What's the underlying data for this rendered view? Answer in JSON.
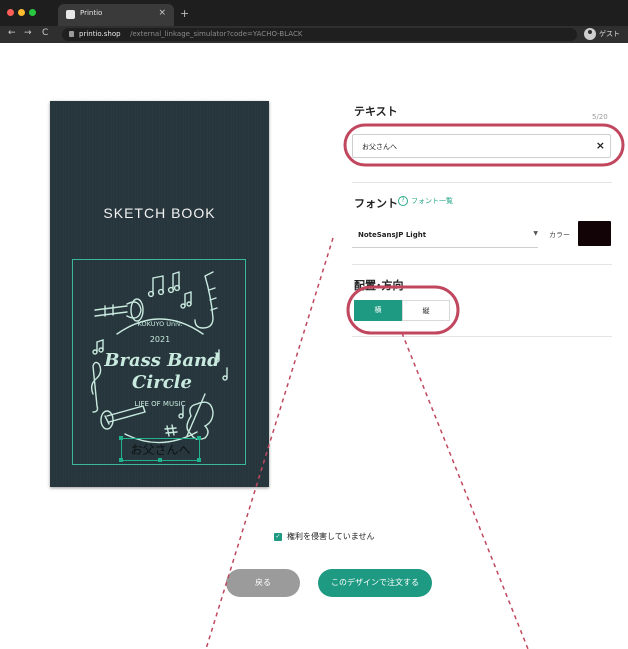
{
  "browser": {
    "tab_title": "Printio",
    "new_tab_symbol": "+",
    "close_symbol": "×",
    "url_host": "printio.shop",
    "url_path": "/external_linkage_simulator?code=YACHO-BLACK",
    "profile_label": "ゲスト",
    "back_symbol": "←",
    "forward_symbol": "→",
    "reload_symbol": "C"
  },
  "preview": {
    "book_title": "SKETCH BOOK",
    "logo_lines": [
      "KOKUYO Univ.",
      "2021",
      "Brass Band",
      "Circle",
      "LIFE OF MUSIC"
    ],
    "custom_text": "お父さんへ",
    "accent_color": "#3bb89a",
    "logo_color": "#c9eadf"
  },
  "form": {
    "text_section": {
      "label": "テキスト",
      "counter": "5/20",
      "value": "お父さんへ",
      "clear_symbol": "×"
    },
    "font_section": {
      "label": "フォント",
      "help_icon_symbol": "?",
      "help_link": "フォント一覧",
      "selected_font": "NoteSansJP Light",
      "dropdown_arrow": "▼",
      "color_label": "カラー",
      "color_value": "#120406"
    },
    "layout_section": {
      "label": "配置･方向",
      "options": [
        "横",
        "縦"
      ],
      "selected": "横"
    }
  },
  "footer": {
    "checkbox_symbol": "✓",
    "checkbox_label": "権利を侵害していません",
    "checked": true,
    "back_button": "戻る",
    "order_button": "このデザインで注文する"
  },
  "colors": {
    "accent": "#1e9a82",
    "highlight": "#c0475e",
    "back_button": "#9b9b9b"
  }
}
